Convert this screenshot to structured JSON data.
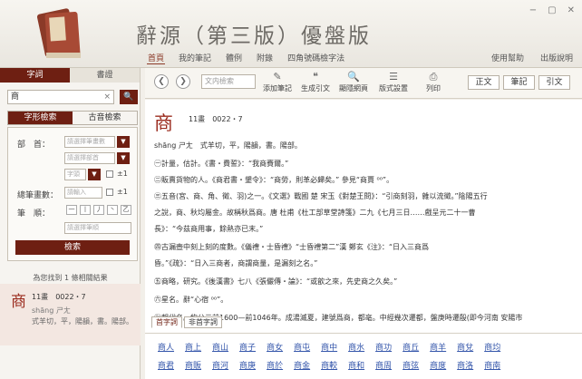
{
  "app": {
    "title": "辭源（第三版）優盤版",
    "nav": [
      "首頁",
      "我的筆記",
      "體例",
      "附錄",
      "四角號碼檢字法"
    ],
    "right_nav": [
      "使用幫助",
      "出版說明"
    ],
    "window_controls": [
      "−",
      "▢",
      "✕"
    ]
  },
  "left": {
    "tabs": [
      "字詞",
      "書證"
    ],
    "search_value": "商",
    "search_button": "🔍",
    "subtabs": [
      "字形檢索",
      "古音檢索"
    ],
    "fields": {
      "radical_label": "部　首：",
      "radical_placeholder": "請選擇筆畫數",
      "radical_sub_placeholder": "請選擇部首",
      "count_placeholder": "字頭",
      "pm": "±1",
      "total_label": "總筆畫數：",
      "total_placeholder": "請輸入",
      "stroke_label": "筆　順：",
      "stroke_buttons": [
        "一",
        "丨",
        "丿",
        "丶",
        "乙"
      ],
      "stroke_placeholder": "請選擇筆順"
    },
    "search_go": "檢索",
    "found_text": "為您找到 1 條相關結果",
    "result": {
      "char": "商",
      "strokes": "11畫",
      "code": "0022・7",
      "pinyin": "shāng ㄕㄤ",
      "def": "式羊切，平，陽韻，書。陽部。"
    }
  },
  "toolbar": {
    "back": "❮",
    "forward": "❯",
    "search_placeholder": "文内檢索",
    "buttons": [
      {
        "label": "添加筆記",
        "icon": "note-icon"
      },
      {
        "label": "生成引文",
        "icon": "quote-icon"
      },
      {
        "label": "顯隱網頁",
        "icon": "search-doc-icon"
      },
      {
        "label": "版式設置",
        "icon": "layout-icon"
      },
      {
        "label": "列印",
        "icon": "print-icon"
      }
    ],
    "view_tabs": [
      "正文",
      "筆記",
      "引文"
    ]
  },
  "entry": {
    "char": "商",
    "strokes": "11畫",
    "code": "0022・7",
    "pinyin": "shāng ㄕㄤ",
    "phonetic": "式羊切，平，陽韻，書。陽部。",
    "lines": [
      "㊀計量，估計。《書・費誓》：“我商賚爾。”",
      "㊁販賣貨物的人。《商君書・墾令》：“商勞，則革必歸矣。” 參見“商賈 ⁰⁰”。",
      "㊂五音(宮、商、角、徵、羽)之一。《文選》戰國 楚 宋玉《對楚王問》：“引商刻羽，雜以流徵。”陰陽五行",
      "之說，商、秋均屬金。故稱秋爲商。唐 杜甫《杜工部草堂詩箋》二九《七月三日……戲呈元二十一曹",
      "長》：“今茲商用事，餘熱亦已末。”",
      "㊃古漏壺中刻上刻的度數。《儀禮・士昏禮》“士昏禮第二”漢 鄭玄《注》：“日入三商爲",
      "昏。”《疏》：“日入三商者，商謂商量，是漏刻之名。”",
      "㊄商略，研究。《後漢書》七八《張儼傳・論》：“或歆之來，先史商之久矣。”",
      "㊅星名。辭“心宿 ⁰⁰”。",
      "㊆朝代名。約公元前1600—前1046年。成湯滅夏，建號爲商，都亳。中經幾次遷都，盤庚時遷殷(即今河南 安陽市"
    ]
  },
  "content_tabs": [
    "首字詞",
    "非首字詞"
  ],
  "words": [
    [
      "商人",
      "商上",
      "商山",
      "商子",
      "商女",
      "商屯",
      "商中",
      "商水",
      "商功",
      "商丘",
      "商羊",
      "商兌",
      "商均"
    ],
    [
      "商君",
      "商販",
      "商河",
      "商庚",
      "商於",
      "商金",
      "商較",
      "商和",
      "商周",
      "商弦",
      "商度",
      "商洛",
      "商南"
    ]
  ]
}
